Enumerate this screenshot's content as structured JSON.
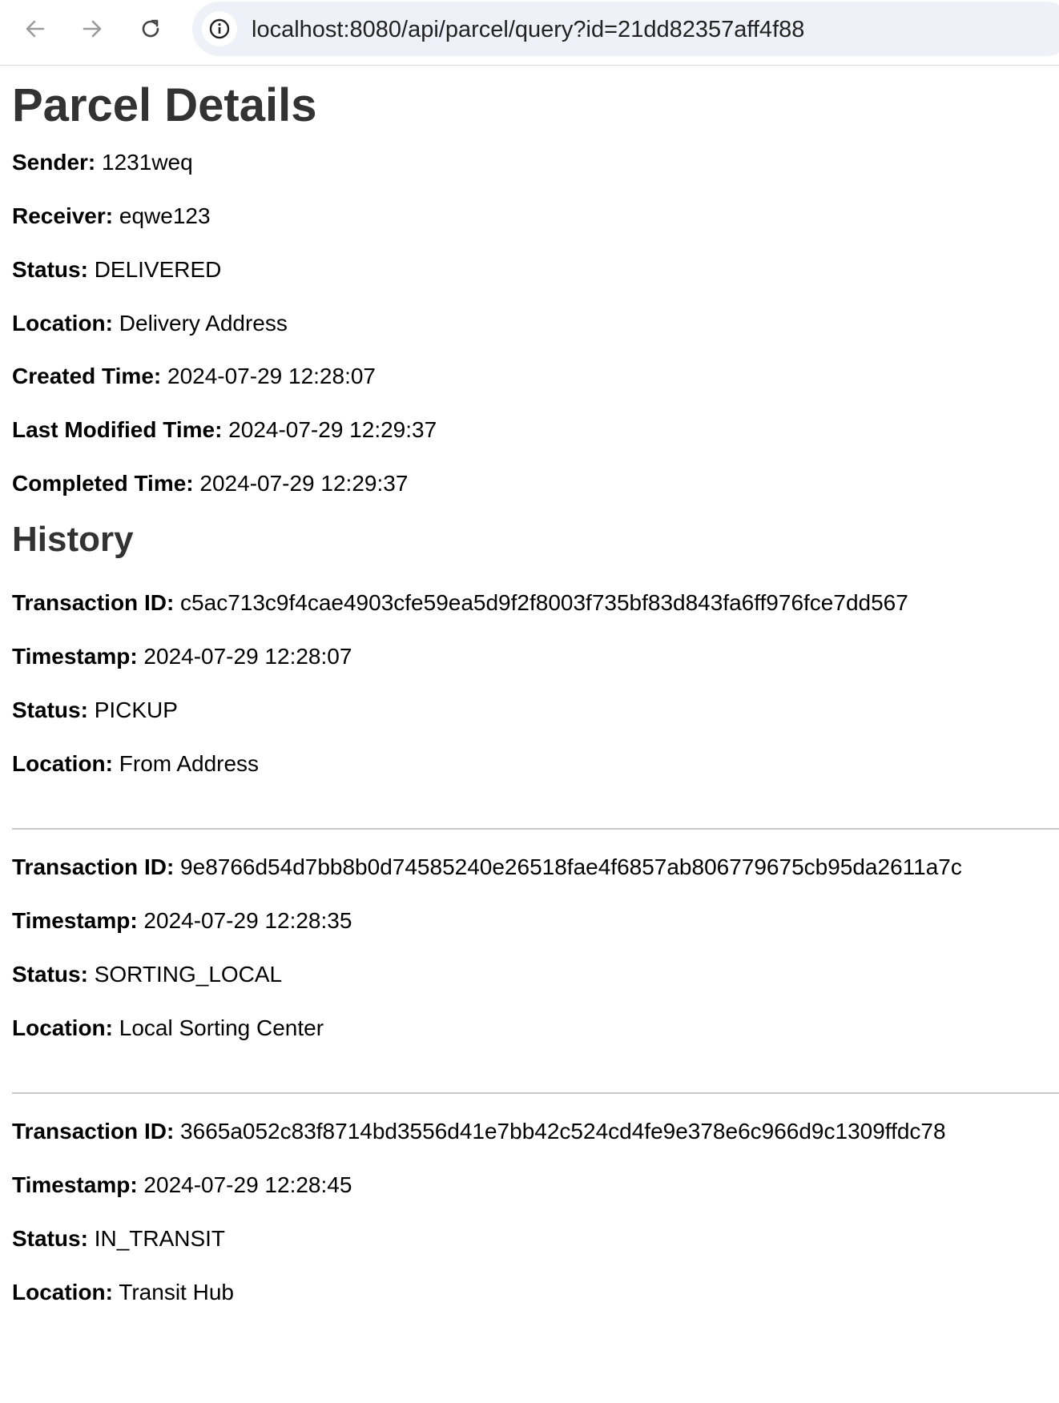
{
  "browser": {
    "url": "localhost:8080/api/parcel/query?id=21dd82357aff4f88",
    "back_icon": "arrow-left-icon",
    "forward_icon": "arrow-right-icon",
    "reload_icon": "reload-icon",
    "site_info_icon": "info-icon"
  },
  "page": {
    "title": "Parcel Details",
    "details": [
      {
        "label": "Sender:",
        "value": "1231weq"
      },
      {
        "label": "Receiver:",
        "value": "eqwe123"
      },
      {
        "label": "Status:",
        "value": "DELIVERED"
      },
      {
        "label": "Location:",
        "value": "Delivery Address"
      },
      {
        "label": "Created Time:",
        "value": "2024-07-29 12:28:07"
      },
      {
        "label": "Last Modified Time:",
        "value": "2024-07-29 12:29:37"
      },
      {
        "label": "Completed Time:",
        "value": "2024-07-29 12:29:37"
      }
    ],
    "history_title": "History",
    "history": [
      {
        "transaction_label": "Transaction ID:",
        "transaction_id": "c5ac713c9f4cae4903cfe59ea5d9f2f8003f735bf83d843fa6ff976fce7dd567",
        "timestamp_label": "Timestamp:",
        "timestamp": "2024-07-29 12:28:07",
        "status_label": "Status:",
        "status": "PICKUP",
        "location_label": "Location:",
        "location": "From Address"
      },
      {
        "transaction_label": "Transaction ID:",
        "transaction_id": "9e8766d54d7bb8b0d74585240e26518fae4f6857ab806779675cb95da2611a7c",
        "timestamp_label": "Timestamp:",
        "timestamp": "2024-07-29 12:28:35",
        "status_label": "Status:",
        "status": "SORTING_LOCAL",
        "location_label": "Location:",
        "location": "Local Sorting Center"
      },
      {
        "transaction_label": "Transaction ID:",
        "transaction_id": "3665a052c83f8714bd3556d41e7bb42c524cd4fe9e378e6c966d9c1309ffdc78",
        "timestamp_label": "Timestamp:",
        "timestamp": "2024-07-29 12:28:45",
        "status_label": "Status:",
        "status": "IN_TRANSIT",
        "location_label": "Location:",
        "location": "Transit Hub"
      }
    ]
  }
}
